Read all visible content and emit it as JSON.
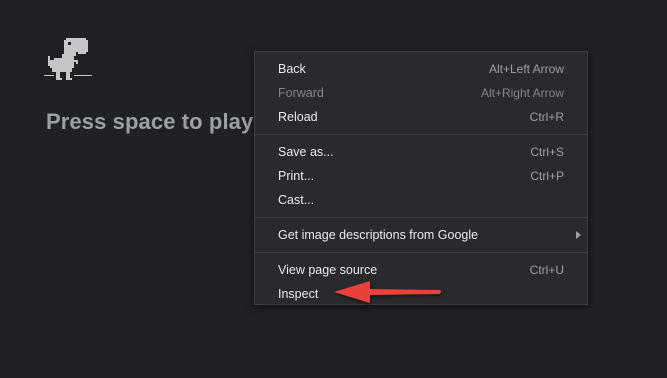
{
  "page": {
    "message": "Press space to play"
  },
  "context_menu": {
    "items": [
      {
        "label": "Back",
        "shortcut": "Alt+Left Arrow",
        "disabled": false
      },
      {
        "label": "Forward",
        "shortcut": "Alt+Right Arrow",
        "disabled": true
      },
      {
        "label": "Reload",
        "shortcut": "Ctrl+R",
        "disabled": false
      },
      {
        "label": "Save as...",
        "shortcut": "Ctrl+S",
        "disabled": false
      },
      {
        "label": "Print...",
        "shortcut": "Ctrl+P",
        "disabled": false
      },
      {
        "label": "Cast...",
        "shortcut": "",
        "disabled": false
      },
      {
        "label": "Get image descriptions from Google",
        "shortcut": "",
        "has_submenu": true,
        "disabled": false
      },
      {
        "label": "View page source",
        "shortcut": "Ctrl+U",
        "disabled": false
      },
      {
        "label": "Inspect",
        "shortcut": "",
        "disabled": false
      }
    ]
  },
  "annotation": {
    "icon": "red-arrow-pointing-left",
    "color": "#e8403a"
  },
  "colors": {
    "background": "#202124",
    "menu_background": "#292a2d",
    "text_muted": "#9aa0a6"
  }
}
